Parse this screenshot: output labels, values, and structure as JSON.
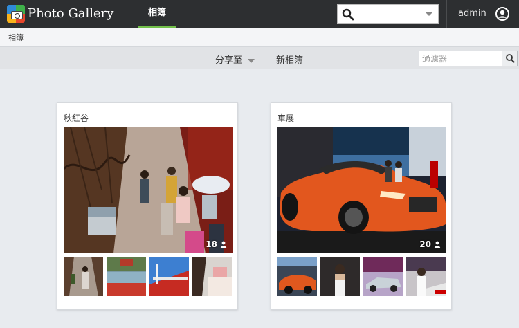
{
  "app": {
    "title": "Photo Gallery"
  },
  "nav": {
    "tab": "相簿"
  },
  "search": {
    "value": "",
    "placeholder": ""
  },
  "user": {
    "name": "admin"
  },
  "breadcrumb": {
    "current": "相簿"
  },
  "toolbar": {
    "share_label": "分享至",
    "new_album_label": "新相簿",
    "filter_placeholder": "過濾器"
  },
  "colors": {
    "accent": "#72c04a",
    "topbar": "#2d2f31"
  },
  "albums": [
    {
      "title": "秋紅谷",
      "count": "18"
    },
    {
      "title": "車展",
      "count": "20"
    }
  ]
}
